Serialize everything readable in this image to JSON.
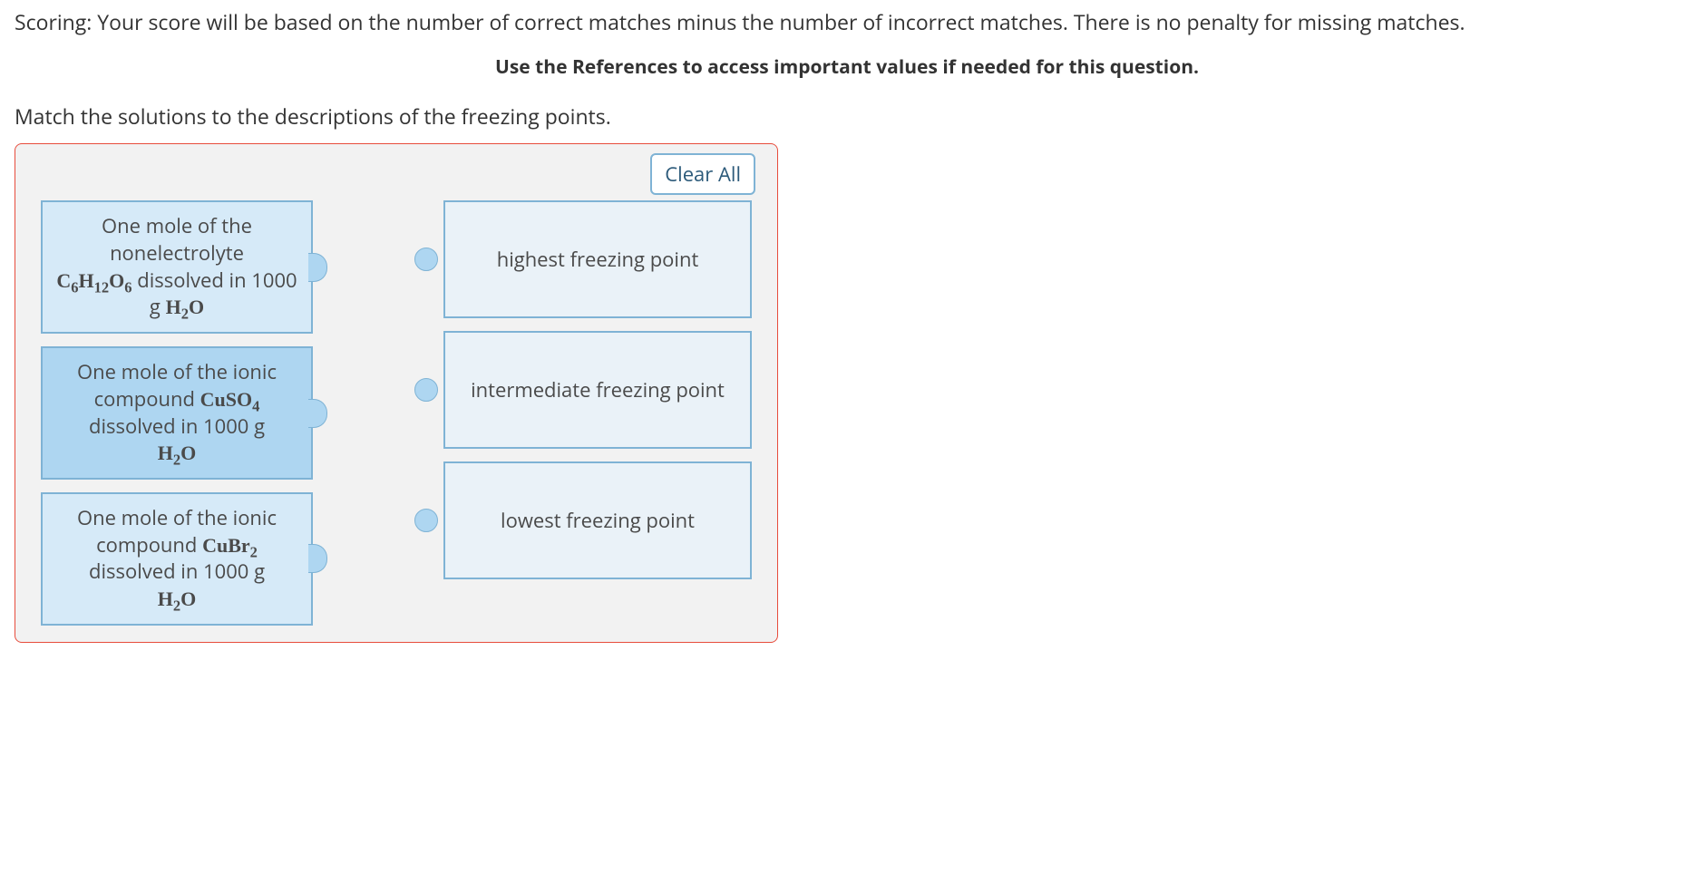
{
  "scoring_text": "Scoring: Your score will be based on the number of correct matches minus the number of incorrect matches. There is no penalty for missing matches.",
  "references_note": "Use the References to access important values if needed for this question.",
  "instruction": "Match the solutions to the descriptions of the freezing points.",
  "clear_all_label": "Clear All",
  "left_items": {
    "item1_pre": "One mole of the nonelectrolyte",
    "item1_formula": "C6H12O6",
    "item1_mid": " dissolved in 1000 g ",
    "item1_solvent": "H2O",
    "item2_pre": "One mole of the ionic compound ",
    "item2_formula": "CuSO4",
    "item2_mid": " dissolved in 1000 g ",
    "item2_solvent": "H2O",
    "item3_pre": "One mole of the ionic compound ",
    "item3_formula": "CuBr2",
    "item3_mid": " dissolved in 1000 g ",
    "item3_solvent": "H2O"
  },
  "right_items": {
    "drop1": "highest freezing point",
    "drop2": "intermediate freezing point",
    "drop3": "lowest freezing point"
  }
}
